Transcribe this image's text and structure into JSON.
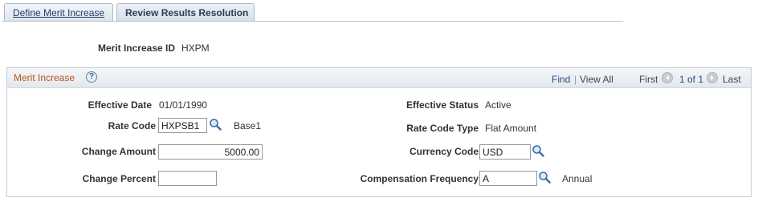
{
  "tabs": [
    {
      "label": "Define Merit Increase"
    },
    {
      "label": "Review Results Resolution"
    }
  ],
  "header": {
    "merit_id_label": "Merit Increase ID",
    "merit_id_value": "HXPM"
  },
  "group": {
    "title": "Merit Increase",
    "find": "Find",
    "separator": "|",
    "view_all": "View All",
    "first": "First",
    "page_info": "1 of 1",
    "last": "Last"
  },
  "fields": {
    "effective_date_label": "Effective Date",
    "effective_date_value": "01/01/1990",
    "effective_status_label": "Effective Status",
    "effective_status_value": "Active",
    "rate_code_label": "Rate Code",
    "rate_code_value": "HXPSB1",
    "rate_code_desc": "Base1",
    "rate_code_type_label": "Rate Code Type",
    "rate_code_type_value": "Flat Amount",
    "change_amount_label": "Change Amount",
    "change_amount_value": "5000.00",
    "currency_code_label": "Currency Code",
    "currency_code_value": "USD",
    "change_percent_label": "Change Percent",
    "change_percent_value": "",
    "comp_freq_label": "Compensation Frequency",
    "comp_freq_value": "A",
    "comp_freq_desc": "Annual"
  },
  "colors": {
    "accent_title": "#b5541e",
    "link": "#2a4d8a",
    "tab_border": "#a9b7c6"
  },
  "icons": [
    "help-icon",
    "first-arrow-icon",
    "last-arrow-icon",
    "lookup-icon"
  ]
}
